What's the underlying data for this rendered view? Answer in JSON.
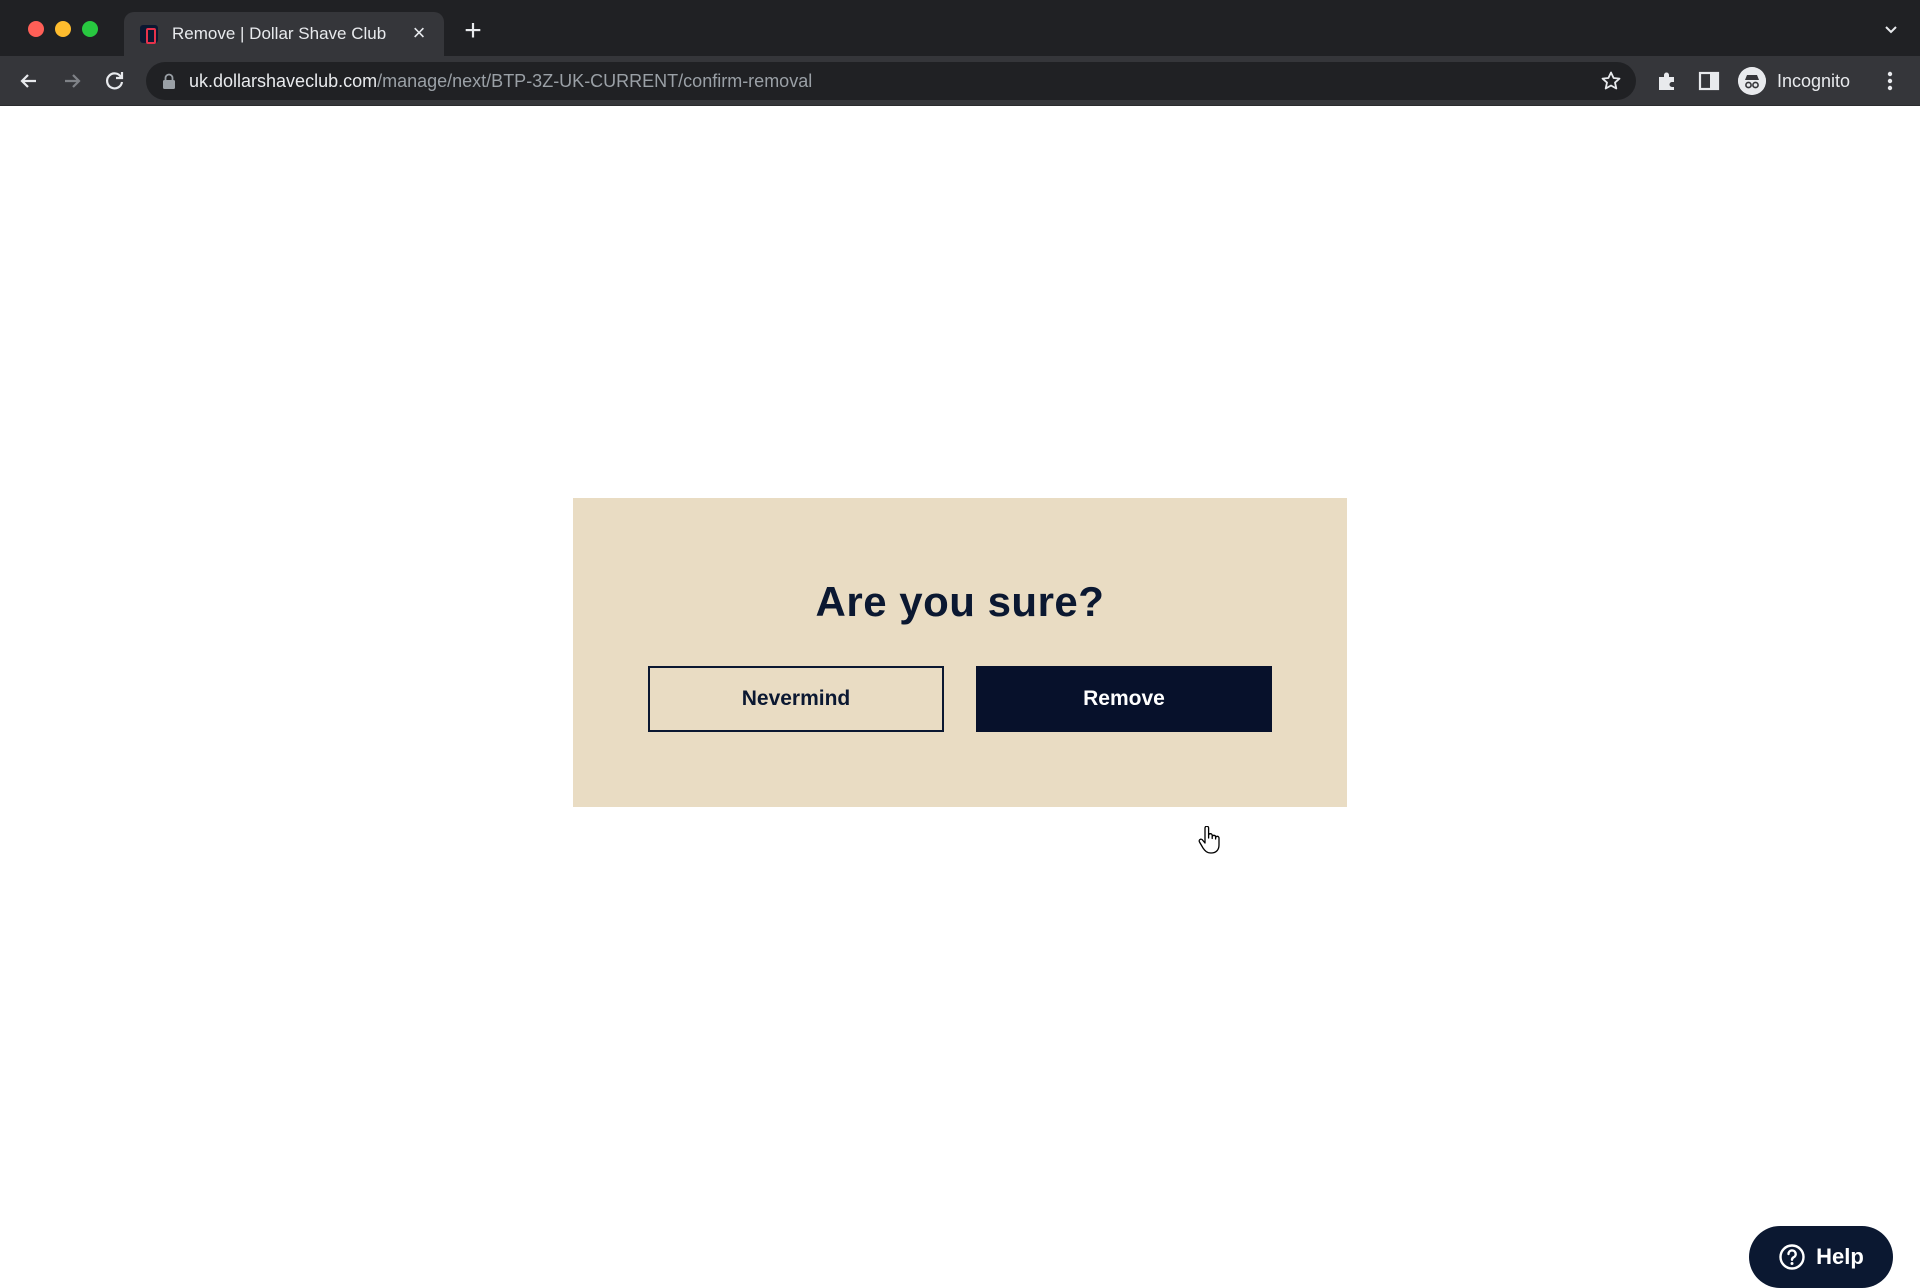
{
  "browser": {
    "tab": {
      "title": "Remove | Dollar Shave Club",
      "favicon": "dollar-shave-club-favicon"
    },
    "address_bar": {
      "host": "uk.dollarshaveclub.com",
      "path": "/manage/next/BTP-3Z-UK-CURRENT/confirm-removal"
    },
    "profile_label": "Incognito"
  },
  "dialog": {
    "title": "Are you sure?",
    "cancel_label": "Nevermind",
    "confirm_label": "Remove"
  },
  "help": {
    "label": "Help"
  },
  "colors": {
    "navy": "#0b1831",
    "modal_background": "#e9dcc3"
  }
}
